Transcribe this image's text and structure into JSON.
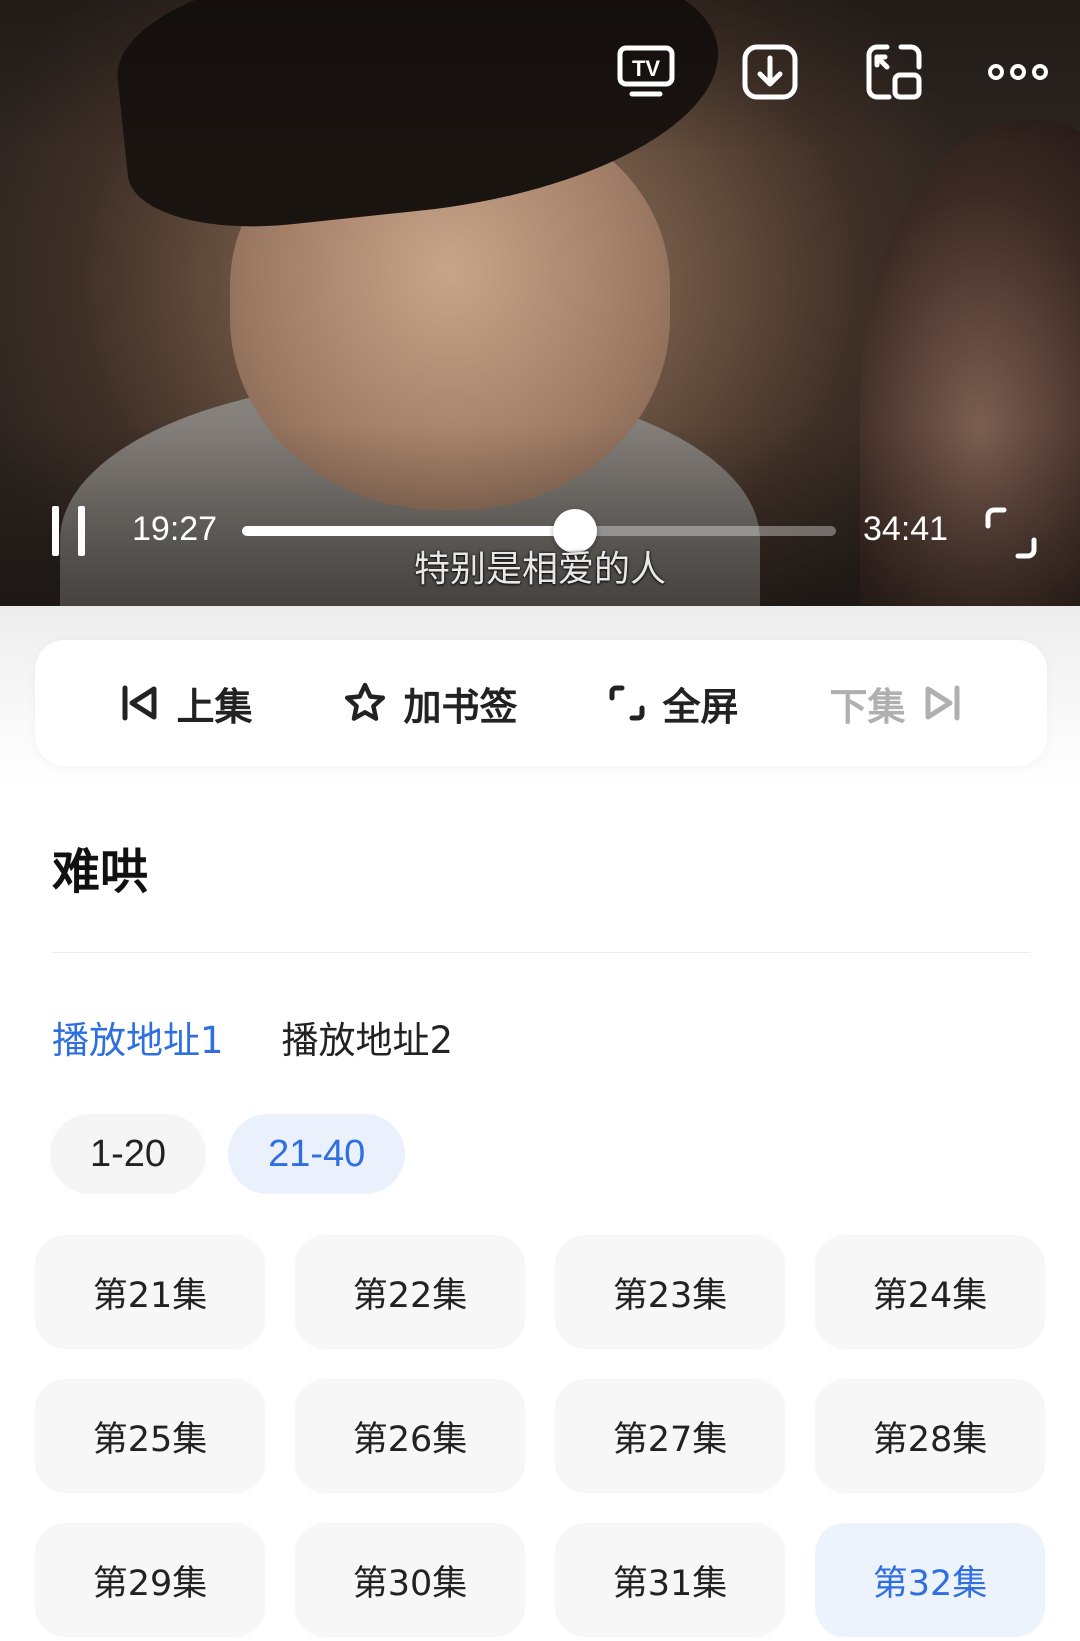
{
  "player": {
    "current_time": "19:27",
    "total_time": "34:41",
    "progress": 0.56,
    "subtitle": "特别是相爱的人",
    "top_icons": [
      "tv-cast-icon",
      "download-icon",
      "pip-icon",
      "more-icon"
    ]
  },
  "actions": {
    "prev": "上集",
    "bookmark": "加书签",
    "fullscreen": "全屏",
    "next": "下集"
  },
  "title": "难哄",
  "sources": [
    {
      "label": "播放地址1",
      "active": true
    },
    {
      "label": "播放地址2",
      "active": false
    }
  ],
  "ranges": [
    {
      "label": "1-20",
      "active": false
    },
    {
      "label": "21-40",
      "active": true
    }
  ],
  "episodes": [
    {
      "label": "第21集",
      "active": false
    },
    {
      "label": "第22集",
      "active": false
    },
    {
      "label": "第23集",
      "active": false
    },
    {
      "label": "第24集",
      "active": false
    },
    {
      "label": "第25集",
      "active": false
    },
    {
      "label": "第26集",
      "active": false
    },
    {
      "label": "第27集",
      "active": false
    },
    {
      "label": "第28集",
      "active": false
    },
    {
      "label": "第29集",
      "active": false
    },
    {
      "label": "第30集",
      "active": false
    },
    {
      "label": "第31集",
      "active": false
    },
    {
      "label": "第32集",
      "active": true
    }
  ],
  "colors": {
    "accent": "#2f6fe0",
    "accent_bg": "#eaf1fd",
    "chip_bg": "#f7f7f7"
  }
}
